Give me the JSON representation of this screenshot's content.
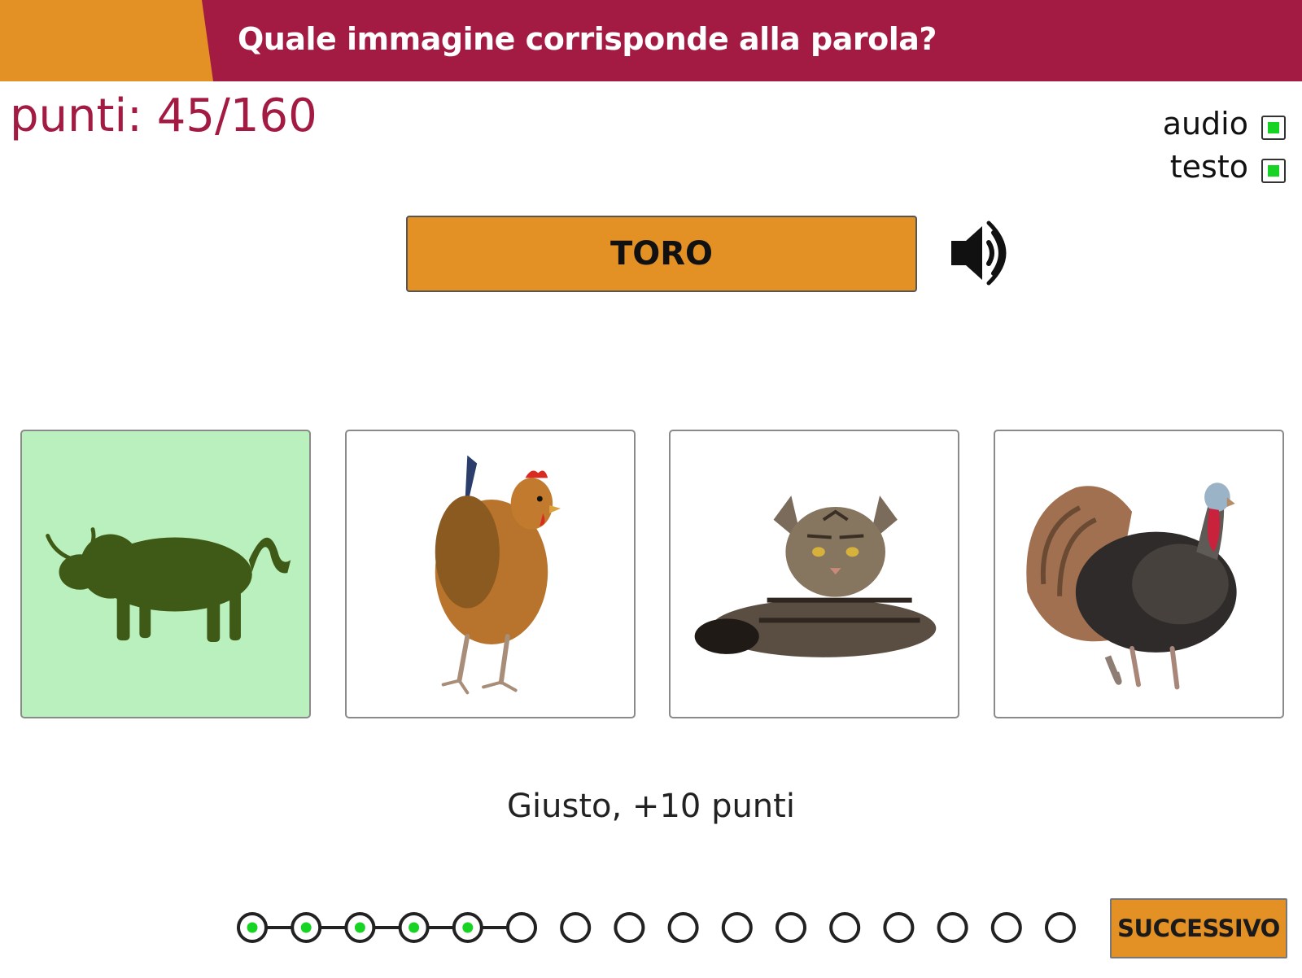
{
  "header": {
    "title": "Quale immagine corrisponde alla parola?"
  },
  "score": {
    "text": "punti: 45/160"
  },
  "options": {
    "audio": {
      "label": "audio",
      "checked": true
    },
    "testo": {
      "label": "testo",
      "checked": true
    }
  },
  "word": "TORO",
  "cards": [
    {
      "animal": "bull-image",
      "selected_correct": true
    },
    {
      "animal": "hen-image",
      "selected_correct": false
    },
    {
      "animal": "cat-image",
      "selected_correct": false
    },
    {
      "animal": "turkey-image",
      "selected_correct": false
    }
  ],
  "feedback": "Giusto, +10 punti",
  "progress": {
    "total": 16,
    "completed": 5
  },
  "next_button": "SUCCESSIVO",
  "colors": {
    "header": "#a31a42",
    "accent_orange": "#e39025",
    "correct_bg": "#b9f0bd",
    "progress_dot": "#17d424"
  }
}
